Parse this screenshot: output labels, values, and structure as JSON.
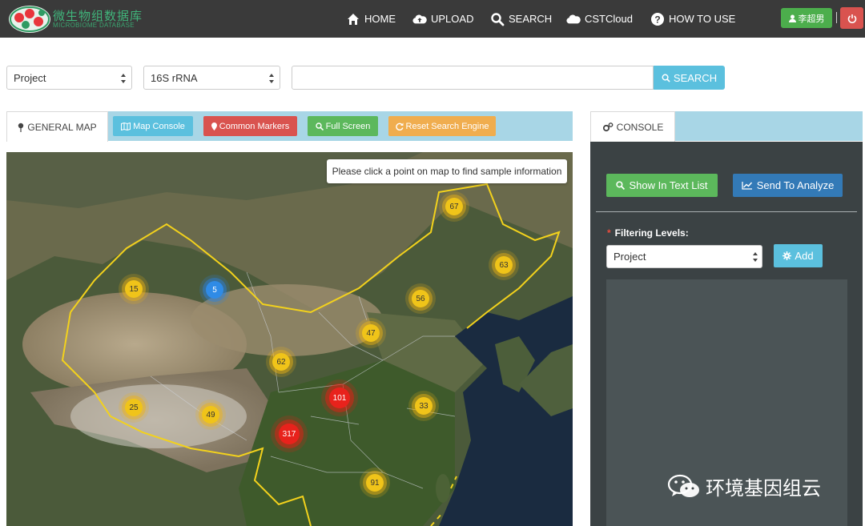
{
  "header": {
    "logo_cn": "微生物组数据库",
    "logo_en": "MICROBIOME DATABASE",
    "nav": [
      {
        "label": "HOME",
        "icon": "home-icon"
      },
      {
        "label": "UPLOAD",
        "icon": "cloud-upload-icon"
      },
      {
        "label": "SEARCH",
        "icon": "search-icon"
      },
      {
        "label": "CSTCloud",
        "icon": "cloud-icon"
      },
      {
        "label": "HOW TO USE",
        "icon": "question-icon"
      }
    ],
    "user_label": "李超男",
    "accent_green": "#4cae4c",
    "accent_red": "#d9534f"
  },
  "search": {
    "type_select": "Project",
    "marker_select": "16S rRNA",
    "query_value": "",
    "button_label": "SEARCH"
  },
  "map_tabs": {
    "active_label": "GENERAL MAP",
    "buttons": [
      {
        "label": "Map Console",
        "color": "#5bc0de"
      },
      {
        "label": "Common Markers",
        "color": "#d9534f"
      },
      {
        "label": "Full Screen",
        "color": "#5cb85c"
      },
      {
        "label": "Reset Search Engine",
        "color": "#f0ad4e"
      }
    ]
  },
  "map": {
    "tooltip": "Please click a point on map to find sample information",
    "clusters": [
      "67",
      "63",
      "15",
      "5",
      "56",
      "47",
      "62",
      "101",
      "33",
      "25",
      "49",
      "317",
      "91"
    ]
  },
  "console": {
    "tab_label": "CONSOLE",
    "show_text_list": "Show In Text List",
    "send_analyze": "Send To Analyze",
    "filter_label": "Filtering Levels:",
    "filter_select": "Project",
    "add_label": "Add"
  },
  "watermark": "环境基因组云"
}
